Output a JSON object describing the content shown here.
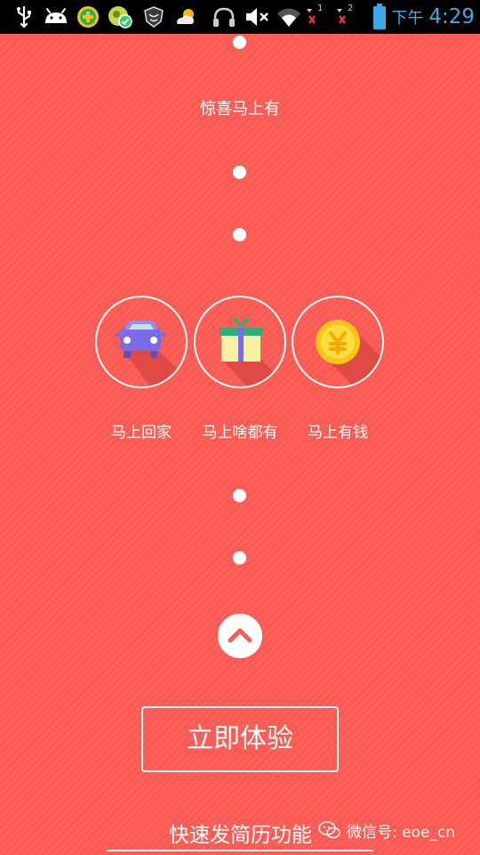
{
  "status_bar": {
    "ampm": "下午",
    "time": "4:29",
    "sim1_label": "1",
    "sim2_label": "2",
    "icons": [
      "usb-icon",
      "android-icon",
      "app-cross-icon",
      "app-check-icon",
      "shield-icon",
      "weather-icon",
      "headphones-icon",
      "mute-icon",
      "wifi-icon",
      "signal-1-icon",
      "signal-2-icon",
      "battery-icon"
    ],
    "time_color": "#3BA9E8"
  },
  "main": {
    "top_label": "惊喜马上有",
    "features": [
      {
        "label": "马上回家",
        "icon": "car-icon"
      },
      {
        "label": "马上啥都有",
        "icon": "gift-icon"
      },
      {
        "label": "马上有钱",
        "icon": "coin-icon"
      }
    ],
    "cta_label": "立即体验",
    "bottom_caption": "快速发简历功能",
    "up_icon": "chevron-up-icon"
  },
  "watermark": {
    "text": "微信号: eoe_cn"
  },
  "colors": {
    "background": "#F95B53",
    "shadow": "#E04A44",
    "white": "#FFFFFF"
  }
}
